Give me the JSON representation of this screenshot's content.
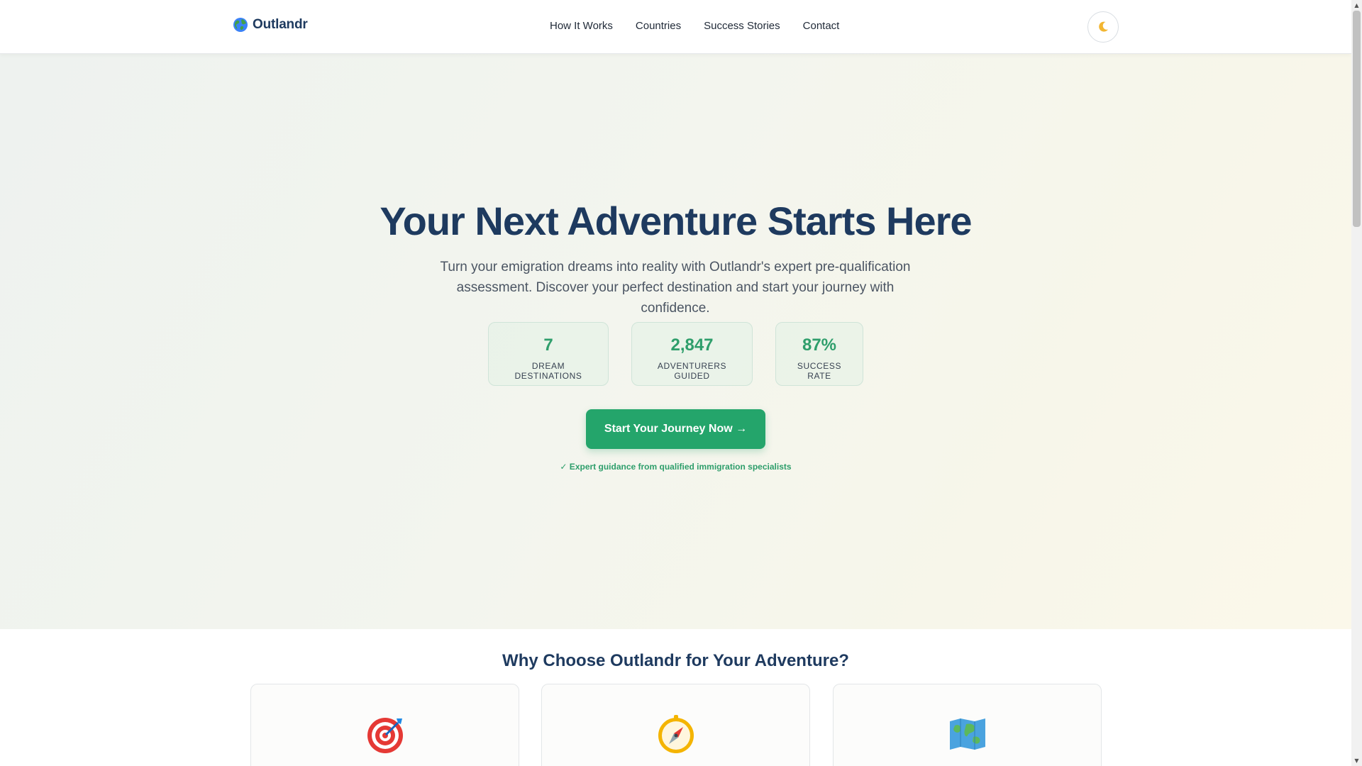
{
  "nav": {
    "brand": "Outlandr",
    "links": [
      "How It Works",
      "Countries",
      "Success Stories",
      "Contact"
    ],
    "theme_toggle_icon": "moon-icon"
  },
  "hero": {
    "title": "Your Next Adventure Starts Here",
    "subtitle": "Turn your emigration dreams into reality with Outlandr's expert pre-qualification assessment. Discover your perfect destination and start your journey with confidence.",
    "stats": [
      {
        "value": "7",
        "label": "DREAM DESTINATIONS"
      },
      {
        "value": "2,847",
        "label": "ADVENTURERS GUIDED"
      },
      {
        "value": "87%",
        "label": "SUCCESS RATE"
      }
    ],
    "cta_label": "Start Your Journey Now →",
    "guarantee": "✓ Expert guidance from qualified immigration specialists"
  },
  "features": {
    "title": "Why Choose Outlandr for Your Adventure?",
    "cards": [
      {
        "icon": "target-icon"
      },
      {
        "icon": "compass-icon"
      },
      {
        "icon": "map-icon"
      }
    ]
  },
  "colors": {
    "brand_navy": "#1e3a5f",
    "accent_green": "#24a56b",
    "stat_green": "#2e9e6b"
  }
}
